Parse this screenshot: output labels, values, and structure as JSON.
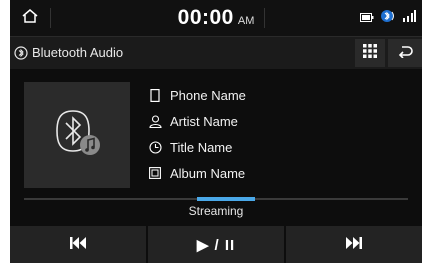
{
  "status_bar": {
    "time": "00:00",
    "ampm": "AM",
    "icons": [
      "home-icon",
      "battery-icon",
      "bluetooth-phone-icon",
      "signal-icon"
    ]
  },
  "title_bar": {
    "title": "Bluetooth Audio",
    "icons": [
      "bluetooth-source-icon",
      "grid-menu-icon",
      "back-icon"
    ]
  },
  "track": {
    "phone_name": "Phone Name",
    "artist_name": "Artist Name",
    "title_name": "Title Name",
    "album_name": "Album Name",
    "icons": [
      "phone-icon",
      "artist-icon",
      "title-icon",
      "album-icon"
    ]
  },
  "album_art": {
    "icon": "bluetooth-music-icon"
  },
  "status_text": "Streaming",
  "controls": {
    "prev_icon": "previous-track-icon",
    "play_pause_label": "▶ / II",
    "next_icon": "next-track-icon"
  },
  "colors": {
    "background": "#0d0d0d",
    "panel": "#232323",
    "accent": "#4aa8e8",
    "text": "#ffffff"
  }
}
